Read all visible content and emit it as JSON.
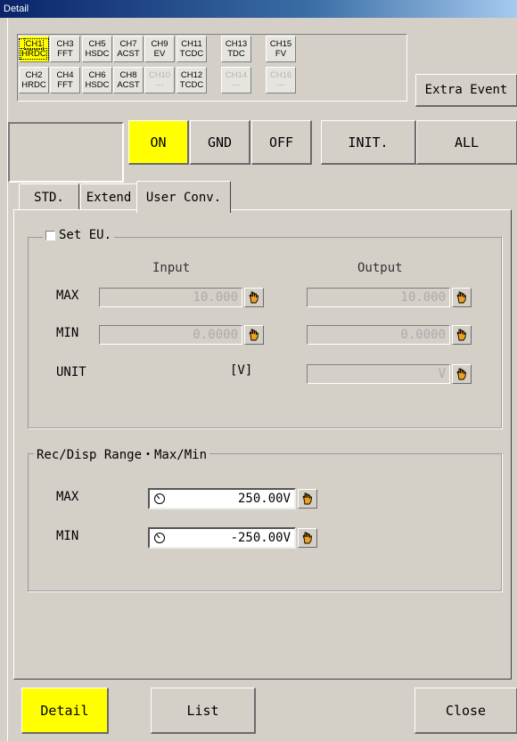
{
  "window": {
    "title": "Detail"
  },
  "channels": {
    "row1": [
      {
        "num": "CH1",
        "mode": "HRDC",
        "selected": true,
        "disabled": false
      },
      {
        "num": "CH3",
        "mode": "FFT",
        "selected": false,
        "disabled": false
      },
      {
        "num": "CH5",
        "mode": "HSDC",
        "selected": false,
        "disabled": false
      },
      {
        "num": "CH7",
        "mode": "ACST",
        "selected": false,
        "disabled": false
      },
      {
        "num": "CH9",
        "mode": "EV",
        "selected": false,
        "disabled": false
      },
      {
        "num": "CH11",
        "mode": "TCDC",
        "selected": false,
        "disabled": false
      },
      {
        "num": "CH13",
        "mode": "TDC",
        "selected": false,
        "disabled": false
      },
      {
        "num": "CH15",
        "mode": "FV",
        "selected": false,
        "disabled": false
      }
    ],
    "row2": [
      {
        "num": "CH2",
        "mode": "HRDC",
        "selected": false,
        "disabled": false
      },
      {
        "num": "CH4",
        "mode": "FFT",
        "selected": false,
        "disabled": false
      },
      {
        "num": "CH6",
        "mode": "HSDC",
        "selected": false,
        "disabled": false
      },
      {
        "num": "CH8",
        "mode": "ACST",
        "selected": false,
        "disabled": false
      },
      {
        "num": "CH10",
        "mode": "---",
        "selected": false,
        "disabled": true
      },
      {
        "num": "CH12",
        "mode": "TCDC",
        "selected": false,
        "disabled": false
      },
      {
        "num": "CH14",
        "mode": "---",
        "selected": false,
        "disabled": true
      },
      {
        "num": "CH16",
        "mode": "---",
        "selected": false,
        "disabled": true
      }
    ],
    "extra_event": "Extra Event"
  },
  "state_buttons": {
    "on": "ON",
    "gnd": "GND",
    "off": "OFF",
    "init": "INIT.",
    "all": "ALL"
  },
  "tabs": [
    "STD.",
    "Extend",
    "User Conv."
  ],
  "eu": {
    "checkbox_label": "Set EU.",
    "checked": false,
    "input_header": "Input",
    "output_header": "Output",
    "max_label": "MAX",
    "min_label": "MIN",
    "unit_label": "UNIT",
    "input_max": "10.000",
    "input_min": "0.0000",
    "input_unit": "[V]",
    "output_max": "10.000",
    "output_min": "0.0000",
    "output_unit": "V"
  },
  "range": {
    "legend": "Rec/Disp Range・Max/Min",
    "max_label": "MAX",
    "min_label": "MIN",
    "max_value": "250.00V",
    "min_value": "-250.00V"
  },
  "bottom": {
    "detail": "Detail",
    "list": "List",
    "close": "Close"
  },
  "colors": {
    "highlight": "#ffff00",
    "face": "#d4d0c8",
    "hand_icon": "#f0a020"
  }
}
